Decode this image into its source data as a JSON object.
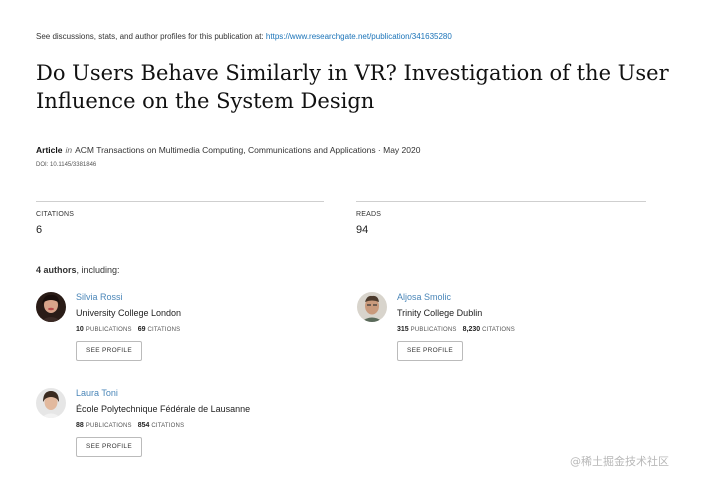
{
  "header": {
    "intro": "See discussions, stats, and author profiles for this publication at:",
    "url": "https://www.researchgate.net/publication/341635280"
  },
  "paper": {
    "title": "Do Users Behave Similarly in VR? Investigation of the User Influence on the System Design",
    "type": "Article",
    "in": "in",
    "venue": "ACM Transactions on Multimedia Computing, Communications and Applications · May 2020",
    "doi": "DOI: 10.1145/3381846"
  },
  "stats": {
    "citations_label": "CITATIONS",
    "citations_value": "6",
    "reads_label": "READS",
    "reads_value": "94"
  },
  "authors_section": {
    "count": "4 authors",
    "suffix": ", including:",
    "pub_label": "PUBLICATIONS",
    "cit_label": "CITATIONS",
    "button_label": "SEE PROFILE"
  },
  "authors": [
    {
      "name": "Silvia Rossi",
      "institution": "University College London",
      "publications": "10",
      "citations": "69",
      "avatar_icon": "person-photo-icon"
    },
    {
      "name": "Aljosa Smolic",
      "institution": "Trinity College Dublin",
      "publications": "315",
      "citations": "8,230",
      "avatar_icon": "person-photo-icon"
    },
    {
      "name": "Laura Toni",
      "institution": "École Polytechnique Fédérale de Lausanne",
      "publications": "88",
      "citations": "854",
      "avatar_icon": "person-photo-icon"
    }
  ],
  "watermark": "@稀土掘金技术社区",
  "colors": {
    "link": "#1a73b8",
    "author_name": "#4a86b8",
    "divider": "#cfcfcf"
  }
}
